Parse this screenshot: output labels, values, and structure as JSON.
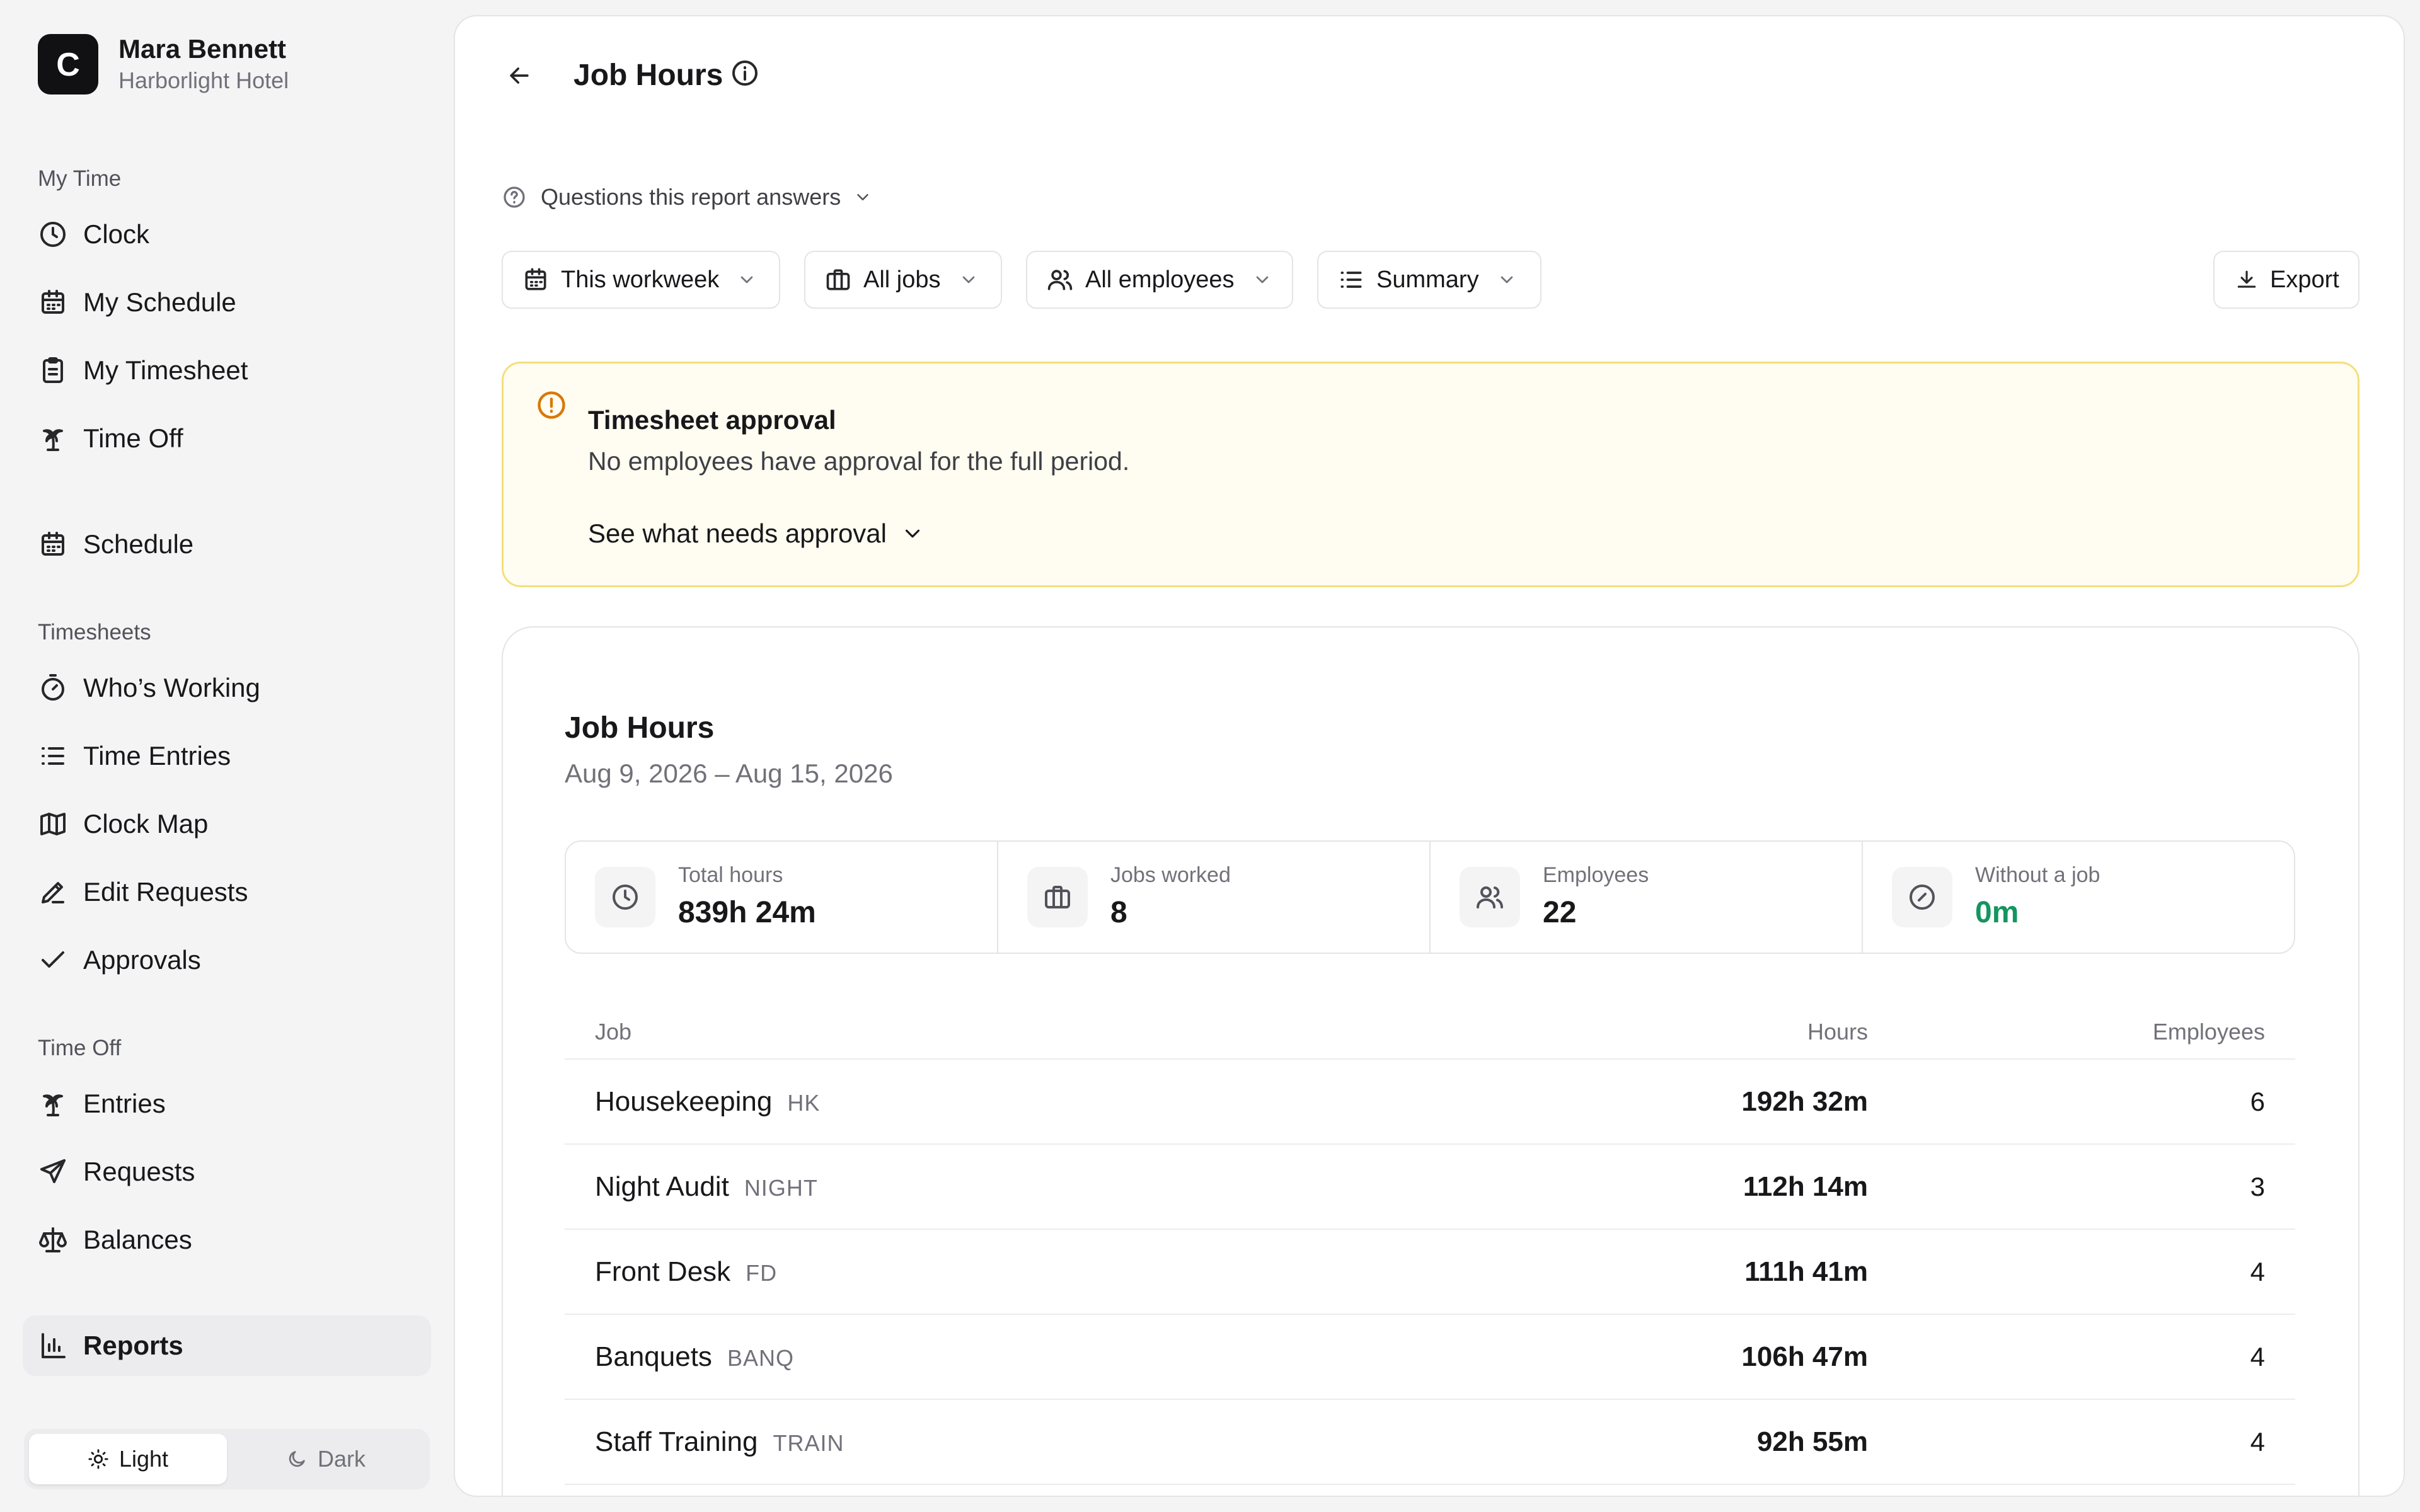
{
  "user": {
    "name": "Mara Bennett",
    "org": "Harborlight Hotel",
    "logo_letter": "C"
  },
  "sidebar": {
    "sections": {
      "my_time": "My Time",
      "timesheets": "Timesheets",
      "time_off": "Time Off"
    },
    "items": {
      "clock": "Clock",
      "my_schedule": "My Schedule",
      "my_timesheet": "My Timesheet",
      "time_off": "Time Off",
      "schedule": "Schedule",
      "whos_working": "Who’s Working",
      "time_entries": "Time Entries",
      "clock_map": "Clock Map",
      "edit_requests": "Edit Requests",
      "approvals": "Approvals",
      "entries": "Entries",
      "requests": "Requests",
      "balances": "Balances",
      "reports": "Reports"
    },
    "active_item": "reports",
    "theme": {
      "light": "Light",
      "dark": "Dark",
      "selected": "light"
    }
  },
  "header": {
    "title": "Job Hours"
  },
  "questions_label": "Questions this report answers",
  "filters": {
    "period": "This workweek",
    "jobs": "All jobs",
    "employees": "All employees",
    "view": "Summary"
  },
  "export_label": "Export",
  "alert": {
    "title": "Timesheet approval",
    "text": "No employees have approval for the full period.",
    "link": "See what needs approval"
  },
  "report": {
    "title": "Job Hours",
    "date_range": "Aug 9, 2026 – Aug 15, 2026",
    "stats": [
      {
        "label": "Total hours",
        "value": "839h 24m",
        "icon": "clock-icon"
      },
      {
        "label": "Jobs worked",
        "value": "8",
        "icon": "briefcase-icon"
      },
      {
        "label": "Employees",
        "value": "22",
        "icon": "users-icon"
      },
      {
        "label": "Without a job",
        "value": "0m",
        "icon": "no-job-icon",
        "color": "#15955f"
      }
    ],
    "columns": {
      "job": "Job",
      "hours": "Hours",
      "employees": "Employees"
    },
    "rows": [
      {
        "job": "Housekeeping",
        "code": "HK",
        "hours": "192h 32m",
        "employees": "6"
      },
      {
        "job": "Night Audit",
        "code": "NIGHT",
        "hours": "112h 14m",
        "employees": "3"
      },
      {
        "job": "Front Desk",
        "code": "FD",
        "hours": "111h 41m",
        "employees": "4"
      },
      {
        "job": "Banquets",
        "code": "BANQ",
        "hours": "106h 47m",
        "employees": "4"
      },
      {
        "job": "Staff Training",
        "code": "TRAIN",
        "hours": "92h 55m",
        "employees": "4"
      }
    ]
  },
  "colors": {
    "accent_green": "#15955f",
    "alert_bg": "#fffcf1",
    "alert_border": "#f3df7c",
    "alert_icon": "#d97706"
  }
}
